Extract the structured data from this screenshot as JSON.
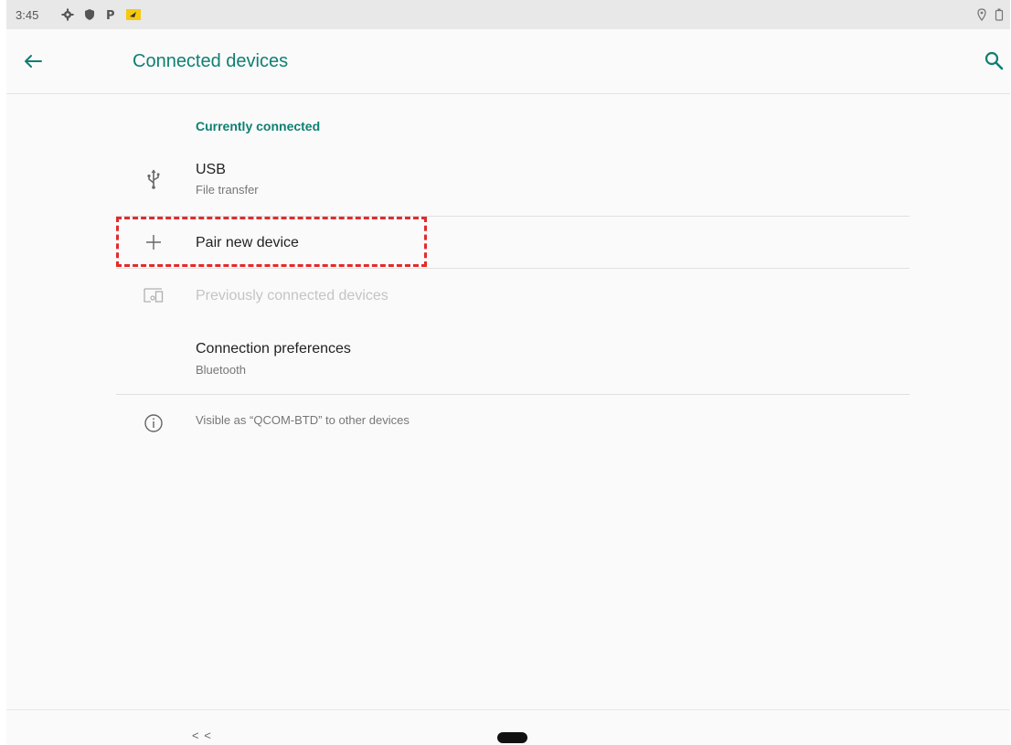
{
  "status_bar": {
    "time": "3:45",
    "left_icons": [
      "settings-icon",
      "shield-icon",
      "parking-icon",
      "notification-icon"
    ],
    "right_icons": [
      "location-icon",
      "battery-icon"
    ]
  },
  "app_bar": {
    "title": "Connected devices",
    "back_icon": "arrow-back-icon",
    "search_icon": "search-icon"
  },
  "sections": {
    "currently_connected_header": "Currently connected",
    "usb": {
      "title": "USB",
      "summary": "File transfer",
      "icon": "usb-icon"
    },
    "pair_new_device": {
      "title": "Pair new device",
      "icon": "plus-icon"
    },
    "previously_connected": {
      "title": "Previously connected devices",
      "icon": "devices-icon",
      "enabled": false
    },
    "connection_preferences": {
      "title": "Connection preferences",
      "summary": "Bluetooth"
    },
    "footer": {
      "text": "Visible as “QCOM-BTD” to other devices",
      "icon": "info-icon"
    }
  },
  "nav_bar": {
    "back_label": "< <",
    "home_icon": "home-pill-icon"
  },
  "colors": {
    "accent": "#0f7f72",
    "highlight": "#e32b2b",
    "background": "#fafafa",
    "status_bar": "#e8e8e8"
  }
}
